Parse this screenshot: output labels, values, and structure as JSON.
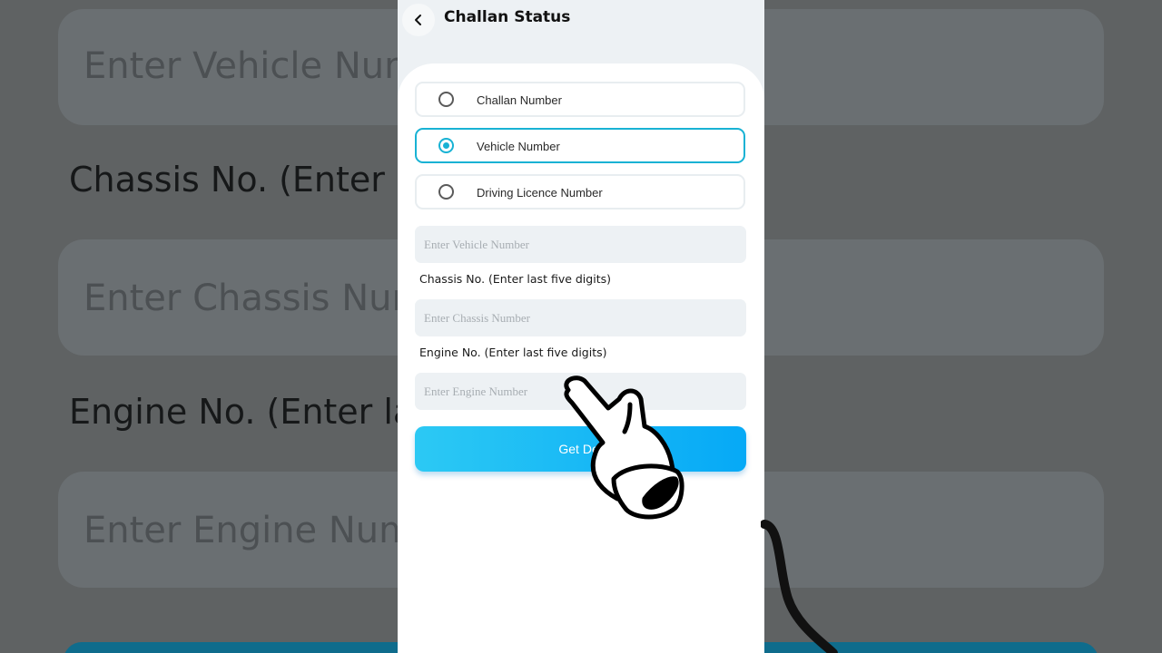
{
  "background": {
    "vehicle_placeholder": "Enter Vehicle Numb",
    "chassis_label": "Chassis No. (Enter l",
    "chassis_placeholder": "Enter Chassis Numb",
    "engine_label": "Engine No. (Enter la",
    "engine_placeholder": "Enter Engine Numb"
  },
  "header": {
    "title": "Challan Status"
  },
  "options": [
    {
      "label": "Challan Number",
      "selected": false
    },
    {
      "label": "Vehicle Number",
      "selected": true
    },
    {
      "label": "Driving Licence Number",
      "selected": false
    }
  ],
  "form": {
    "vehicle_placeholder": "Enter Vehicle Number",
    "chassis_label": "Chassis No. (Enter last five digits)",
    "chassis_placeholder": "Enter Chassis Number",
    "engine_label": "Engine No. (Enter last five digits)",
    "engine_placeholder": "Enter Engine Number",
    "submit_label": "Get Det"
  },
  "colors": {
    "accent": "#18b2d4",
    "button_start": "#2cc9f4",
    "button_end": "#06a9f6",
    "input_bg": "#edf1f4"
  },
  "icons": {
    "back": "chevron-left-icon",
    "pointer": "pointing-hand-icon"
  }
}
